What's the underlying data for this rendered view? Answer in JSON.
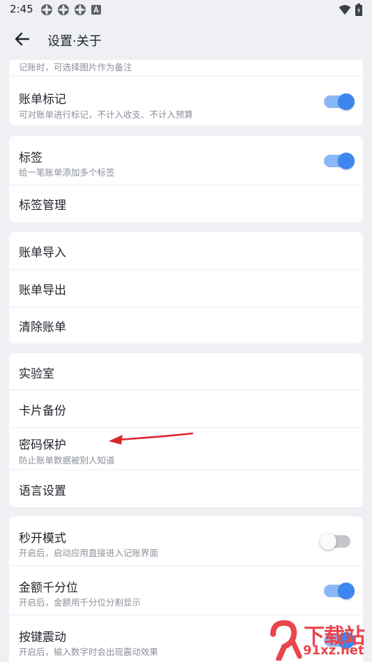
{
  "status_bar": {
    "time": "2:45"
  },
  "header": {
    "title": "设置·关于"
  },
  "cards": {
    "bill": {
      "partial_sub": "记账时，可选择图片作为备注",
      "mark_title": "账单标记",
      "mark_sub": "可对账单进行标记，不计入收支、不计入预算",
      "mark_enabled": true
    },
    "tags": {
      "tag_title": "标签",
      "tag_sub": "给一笔账单添加多个标签",
      "tag_enabled": true,
      "manage_title": "标签管理"
    },
    "data": {
      "import_title": "账单导入",
      "export_title": "账单导出",
      "clear_title": "清除账单"
    },
    "misc": {
      "lab_title": "实验室",
      "backup_title": "卡片备份",
      "password_title": "密码保护",
      "password_sub": "防止账单数据被别人知道",
      "language_title": "语言设置"
    },
    "prefs": {
      "quick_title": "秒开模式",
      "quick_sub": "开启后，启动应用直接进入记账界面",
      "quick_enabled": false,
      "thousands_title": "金额千分位",
      "thousands_sub": "开启后，金额用千分位分割显示",
      "thousands_enabled": true,
      "vibrate_title": "按键震动",
      "vibrate_sub": "开启后，输入数字时会出现震动效果",
      "vibrate_enabled": true
    }
  },
  "watermark": {
    "brand": "下载站",
    "url": "91xz.net"
  },
  "colors": {
    "accent": "#3d86ef",
    "background": "#eef0f3",
    "annotation_arrow": "#d9262c"
  }
}
